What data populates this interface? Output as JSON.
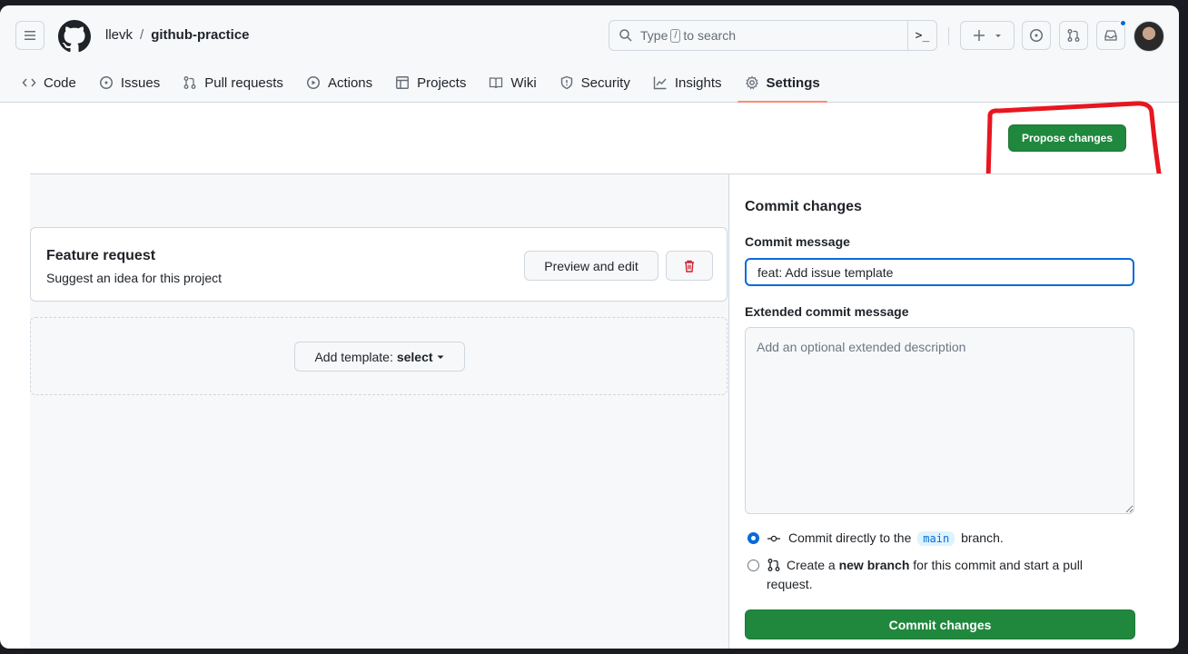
{
  "header": {
    "owner": "llevk",
    "separator": "/",
    "repo": "github-practice",
    "search": {
      "prefix": "Type",
      "key": "/",
      "suffix": "to search",
      "terminal_icon": ">_"
    }
  },
  "tabs": [
    {
      "label": "Code",
      "icon": "code-icon"
    },
    {
      "label": "Issues",
      "icon": "issue-icon"
    },
    {
      "label": "Pull requests",
      "icon": "pull-request-icon"
    },
    {
      "label": "Actions",
      "icon": "play-icon"
    },
    {
      "label": "Projects",
      "icon": "table-icon"
    },
    {
      "label": "Wiki",
      "icon": "book-icon"
    },
    {
      "label": "Security",
      "icon": "shield-icon"
    },
    {
      "label": "Insights",
      "icon": "graph-icon"
    },
    {
      "label": "Settings",
      "icon": "gear-icon",
      "selected": true
    }
  ],
  "toolbar": {
    "propose_label": "Propose changes"
  },
  "template": {
    "name": "Feature request",
    "about": "Suggest an idea for this project",
    "preview_label": "Preview and edit",
    "add_prefix": "Add template:",
    "add_select": "select"
  },
  "commit": {
    "title": "Commit changes",
    "message_label": "Commit message",
    "message_value": "feat: Add issue template",
    "extended_label": "Extended commit message",
    "extended_placeholder": "Add an optional extended description",
    "option1_prefix": "Commit directly to the",
    "branch": "main",
    "option1_suffix": "branch.",
    "option2_prefix": "Create a",
    "option2_bold": "new branch",
    "option2_suffix": "for this commit and start a pull",
    "option2_line2": "request.",
    "button_label": "Commit changes"
  },
  "colors": {
    "primary_green": "#1f883d",
    "accent_blue": "#0969da",
    "tab_underline": "#fd8c73",
    "danger": "#cf222e",
    "annotation_red": "#e8161f"
  }
}
